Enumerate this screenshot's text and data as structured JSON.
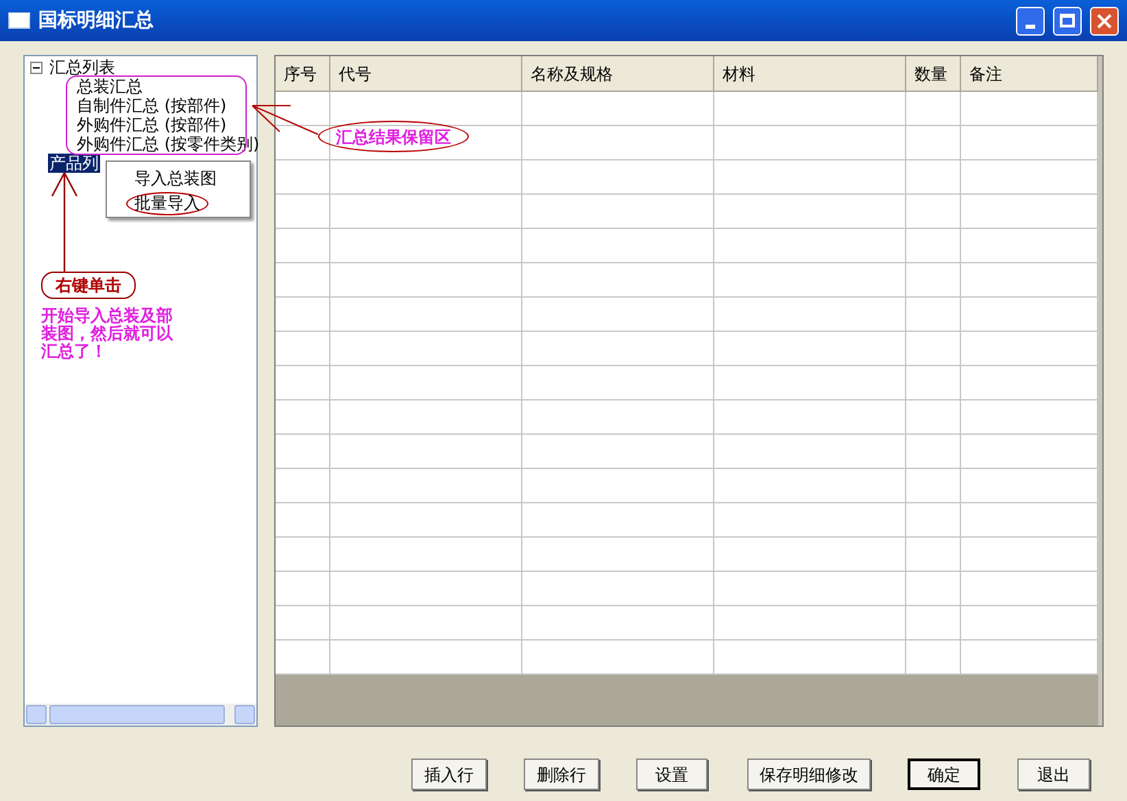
{
  "window": {
    "title": "国标明细汇总"
  },
  "tree": [
    {
      "label": "汇总列表",
      "expanded": true,
      "selected": false,
      "children": [
        {
          "label": "总装汇总"
        },
        {
          "label": "自制件汇总 (按部件)"
        },
        {
          "label": "外购件汇总 (按部件)"
        },
        {
          "label": "外购件汇总 (按零件类别)"
        }
      ]
    },
    {
      "label": "产品列",
      "selected": true
    }
  ],
  "context_menu": [
    {
      "label": "导入总装图",
      "circled": false
    },
    {
      "label": "批量导入",
      "circled": true
    }
  ],
  "annotations": [
    {
      "kind": "ellipse",
      "text": "汇总结果保留区"
    },
    {
      "kind": "box",
      "text": "右键单击"
    },
    {
      "kind": "note",
      "text": "开始导入总装及部装图，然后就可以汇总了！"
    }
  ],
  "table": {
    "columns": [
      "序号",
      "代号",
      "名称及规格",
      "材料",
      "数量",
      "备注"
    ]
  },
  "buttons": [
    {
      "label": "插入行",
      "default": false
    },
    {
      "label": "删除行",
      "default": false
    },
    {
      "label": "设置",
      "default": false
    },
    {
      "label": "保存明细修改",
      "default": false
    },
    {
      "label": "确定",
      "default": true
    },
    {
      "label": "退出",
      "default": false
    }
  ]
}
